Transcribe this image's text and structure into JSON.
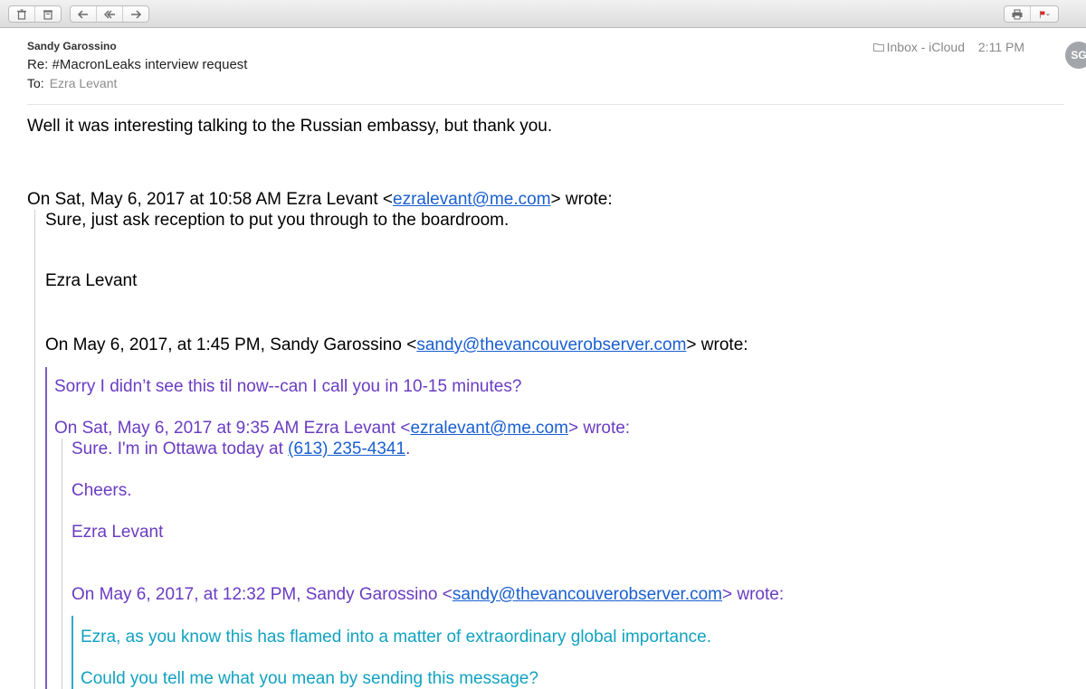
{
  "toolbar": {
    "left_buttons": [
      "trash-icon",
      "junk-icon"
    ],
    "reply_buttons": [
      "reply-icon",
      "reply-all-icon",
      "forward-icon"
    ],
    "right_buttons": [
      "print-icon",
      "flag-icon"
    ],
    "flag_color": "#e0262b"
  },
  "header": {
    "sender": "Sandy Garossino",
    "subject": "Re: #MacronLeaks interview request",
    "to_label": "To:",
    "to_value": "Ezra Levant",
    "mailbox": "Inbox - iCloud",
    "time": "2:11 PM",
    "avatar_initials": "SG"
  },
  "message": {
    "line1": "Well it was interesting talking to the Russian embassy, but thank you.",
    "attr1_pre": "On Sat, May 6, 2017 at 10:58 AM Ezra Levant <",
    "attr1_link": "ezralevant@me.com",
    "attr1_post": "> wrote:",
    "q1_line1": "Sure, just ask reception to put you through to the boardroom.",
    "q1_sig": "Ezra Levant",
    "attr2_pre": "On May 6, 2017, at 1:45 PM, Sandy Garossino <",
    "attr2_link": "sandy@thevancouverobserver.com",
    "attr2_post": "> wrote:",
    "q2_line1": "Sorry I didn’t see this til now--can I call you in 10-15 minutes?",
    "attr3_pre": "On Sat, May 6, 2017 at 9:35 AM Ezra Levant <",
    "attr3_link": "ezralevant@me.com",
    "attr3_post": "> wrote:",
    "q3_line1_pre": "Sure. I'm in Ottawa today at ",
    "q3_phone": "(613) 235-4341",
    "q3_line1_post": ".",
    "q3_cheers": "Cheers.",
    "q3_sig": "Ezra Levant",
    "attr4_pre": "On May 6, 2017, at 12:32 PM, Sandy Garossino <",
    "attr4_link": "sandy@thevancouverobserver.com",
    "attr4_post": "> wrote:",
    "q4_line1": "Ezra, as you know this has flamed into a matter of extraordinary global importance.",
    "q4_line2": "Could you tell me what you mean by sending this message?"
  }
}
